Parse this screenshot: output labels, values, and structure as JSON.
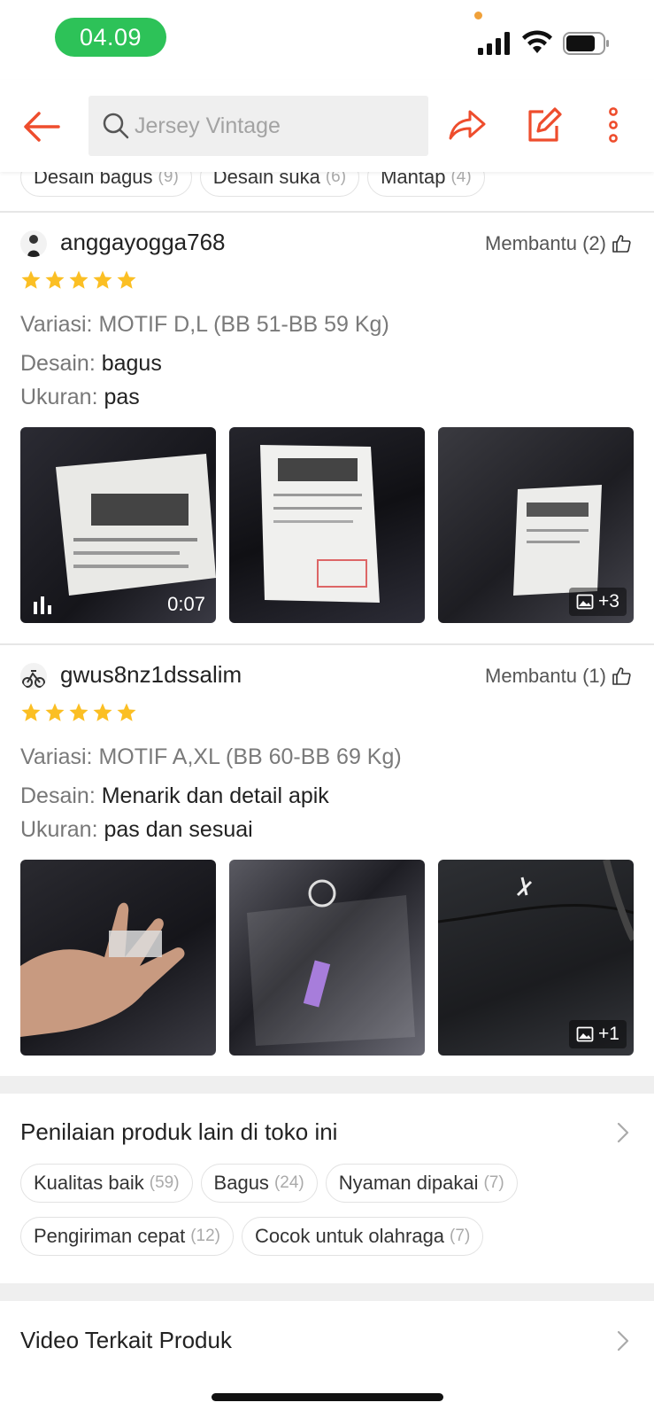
{
  "status_bar": {
    "time": "04.09",
    "time_pill_color": "#2dc258"
  },
  "nav": {
    "search_placeholder": "Jersey Vintage",
    "accent_color": "#ee4d2d",
    "icons": [
      "back-arrow-icon",
      "search-icon",
      "share-icon",
      "edit-icon",
      "more-icon"
    ]
  },
  "top_chips": [
    {
      "label": "Desain bagus",
      "count": "(9)"
    },
    {
      "label": "Desain suka",
      "count": "(6)"
    },
    {
      "label": "Mantap",
      "count": "(4)"
    }
  ],
  "reviews": [
    {
      "username": "anggayogga768",
      "helpful": "Membantu (2)",
      "stars": 5,
      "variasi": "Variasi: MOTIF D,L (BB 51-BB 59 Kg)",
      "desain_label": "Desain:",
      "desain_value": "bagus",
      "ukuran_label": "Ukuran:",
      "ukuran_value": "pas",
      "media": [
        {
          "kind": "video",
          "duration": "0:07"
        },
        {
          "kind": "image"
        },
        {
          "kind": "image",
          "more": "+3"
        }
      ]
    },
    {
      "username": "gwus8nz1dssalim",
      "helpful": "Membantu (1)",
      "stars": 5,
      "variasi": "Variasi: MOTIF A,XL (BB 60-BB 69 Kg)",
      "desain_label": "Desain:",
      "desain_value": "Menarik dan detail apik",
      "ukuran_label": "Ukuran:",
      "ukuran_value": "pas dan sesuai",
      "media": [
        {
          "kind": "image"
        },
        {
          "kind": "image"
        },
        {
          "kind": "image",
          "more": "+1"
        }
      ]
    }
  ],
  "other_ratings": {
    "title": "Penilaian produk lain di toko ini",
    "chips_row1": [
      {
        "label": "Kualitas baik",
        "count": "(59)"
      },
      {
        "label": "Bagus",
        "count": "(24)"
      },
      {
        "label": "Nyaman dipakai",
        "count": "(7)"
      }
    ],
    "chips_row2": [
      {
        "label": "Pengiriman cepat",
        "count": "(12)"
      },
      {
        "label": "Cocok untuk olahraga",
        "count": "(7)"
      }
    ]
  },
  "related_video": {
    "title": "Video Terkait Produk"
  },
  "star_color": "#fbbf24"
}
